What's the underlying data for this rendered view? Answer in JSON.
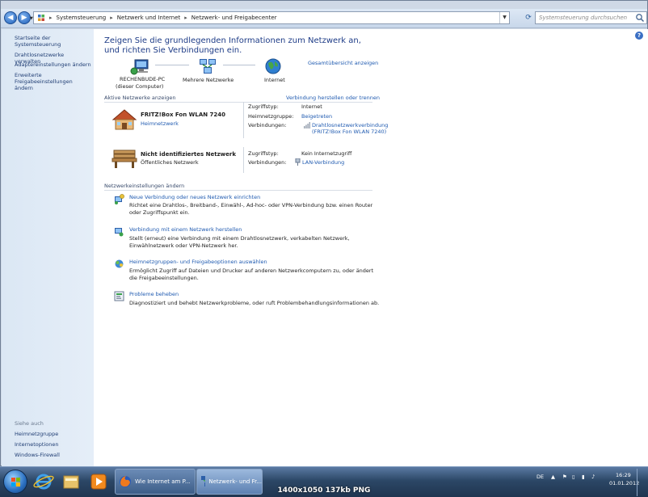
{
  "address_bar": {
    "crumbs": [
      "Systemsteuerung",
      "Netzwerk und Internet",
      "Netzwerk- und Freigabecenter"
    ],
    "search_placeholder": "Systemsteuerung durchsuchen"
  },
  "left_pane": {
    "links": [
      "Startseite der Systemsteuerung",
      "Drahtlosnetzwerke verwalten",
      "Adaptereinstellungen ändern",
      "Erweiterte Freigabeeinstellungen ändern"
    ],
    "see_also_heading": "Siehe auch",
    "see_also": [
      "Heimnetzgruppe",
      "Internetoptionen",
      "Windows-Firewall"
    ]
  },
  "main": {
    "title": "Zeigen Sie die grundlegenden Informationen zum Netzwerk an, und richten Sie Verbindungen ein.",
    "full_map_link": "Gesamtübersicht anzeigen",
    "map": {
      "pc_name": "RECHENBUDE-PC",
      "pc_sub": "(dieser Computer)",
      "multi": "Mehrere Netzwerke",
      "internet": "Internet"
    },
    "active_networks_heading": "Aktive Netzwerke anzeigen",
    "connect_disconnect_link": "Verbindung herstellen oder trennen",
    "networks": [
      {
        "name": "FRITZ!Box Fon WLAN 7240",
        "type": "Heimnetzwerk",
        "access_label": "Zugriffstyp:",
        "access_value": "Internet",
        "homegroup_label": "Heimnetzgruppe:",
        "homegroup_value": "Beigetreten",
        "conn_label": "Verbindungen:",
        "conn_value_1": "Drahtlosnetzwerkverbindung",
        "conn_value_2": "(FRITZ!Box Fon WLAN 7240)"
      },
      {
        "name": "Nicht identifiziertes Netzwerk",
        "type": "Öffentliches Netzwerk",
        "access_label": "Zugriffstyp:",
        "access_value": "Kein Internetzugriff",
        "conn_label": "Verbindungen:",
        "conn_value_1": "LAN-Verbindung"
      }
    ],
    "change_settings_heading": "Netzwerkeinstellungen ändern",
    "tasks": [
      {
        "link": "Neue Verbindung oder neues Netzwerk einrichten",
        "desc": "Richtet eine Drahtlos-, Breitband-, Einwähl-, Ad-hoc- oder VPN-Verbindung bzw. einen Router oder Zugriffspunkt ein."
      },
      {
        "link": "Verbindung mit einem Netzwerk herstellen",
        "desc": "Stellt (erneut) eine Verbindung mit einem Drahtlosnetzwerk, verkabelten Netzwerk, Einwählnetzwerk oder VPN-Netzwerk her."
      },
      {
        "link": "Heimnetzgruppen- und Freigabeoptionen auswählen",
        "desc": "Ermöglicht Zugriff auf Dateien und Drucker auf anderen Netzwerkcomputern zu, oder ändert die Freigabeeinstellungen."
      },
      {
        "link": "Probleme beheben",
        "desc": "Diagnostiziert und behebt Netzwerkprobleme, oder ruft Problembehandlungsinformationen ab."
      }
    ]
  },
  "taskbar": {
    "tasks": [
      "Wie Internet am P...",
      "Netzwerk- und Fr..."
    ],
    "lang": "DE",
    "time": "16:29",
    "date": "01.01.2012"
  },
  "overlay_caption": "1400x1050  137kb  PNG"
}
